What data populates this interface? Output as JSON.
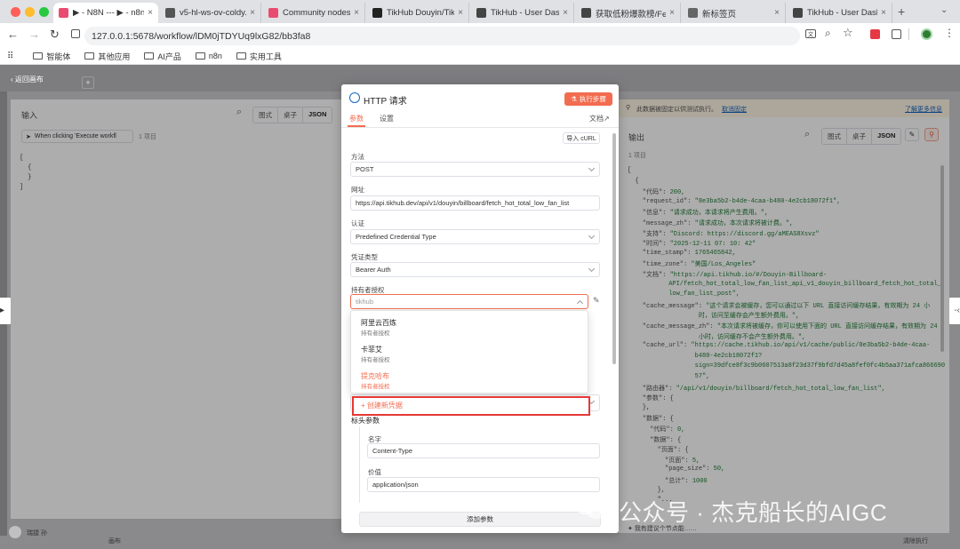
{
  "browser": {
    "tabs": [
      {
        "title": "▶ - N8N --- ▶ - n8n",
        "active": true,
        "fav": "#ea4b71"
      },
      {
        "title": "v5-hl-ws-ov-coldy.d",
        "active": false,
        "fav": "#555"
      },
      {
        "title": "Community nodes",
        "active": false,
        "fav": "#ea4b71"
      },
      {
        "title": "TikHub Douyin/TikTo",
        "active": false,
        "fav": "#222"
      },
      {
        "title": "TikHub - User Dash",
        "active": false,
        "fav": "#444"
      },
      {
        "title": "获取低粉爆款榜/Fetc",
        "active": false,
        "fav": "#444"
      },
      {
        "title": "新标签页",
        "active": false,
        "fav": "#666"
      },
      {
        "title": "TikHub - User Dash",
        "active": false,
        "fav": "#444"
      }
    ],
    "url": "127.0.0.1:5678/workflow/lDM0jTDYUq9lxG82/bb3fa8",
    "bookmarks": [
      "智能体",
      "其他应用",
      "AI产品",
      "n8n",
      "实用工具"
    ]
  },
  "canvas": {
    "back_label": "返回画布",
    "user_label": "瑞捷 孙",
    "bottom_label": "画布"
  },
  "input_panel": {
    "title": "输入",
    "view_modes": [
      "图式",
      "桌子",
      "JSON"
    ],
    "trigger_select": "When clicking 'Execute workfl",
    "item_count": "1 项目",
    "json_lines": [
      "[",
      "  {",
      "  }",
      "]"
    ]
  },
  "http_panel": {
    "title": "HTTP 请求",
    "execute_button": "执行步骤",
    "tabs": {
      "params": "参数",
      "settings": "设置",
      "docs": "文档"
    },
    "import_curl": "导入 cURL",
    "method_label": "方法",
    "method_value": "POST",
    "url_label": "网址",
    "url_value": "https://api.tikhub.dev/api/v1/douyin/billboard/fetch_hot_total_low_fan_list",
    "auth_label": "认证",
    "auth_value": "Predefined Credential Type",
    "credential_type_label": "凭证类型",
    "credential_type_value": "Bearer Auth",
    "bearer_label": "持有者授权",
    "bearer_search_value": "tikhub",
    "dropdown": [
      {
        "name": "阿里云百炼",
        "sub": "持有者授权",
        "highlight": false
      },
      {
        "name": "卡菲艾",
        "sub": "持有者授权",
        "highlight": false
      },
      {
        "name": "提克哈布",
        "sub": "持有者授权",
        "highlight": true
      }
    ],
    "create_credential": "+ 创建新凭据",
    "headers_label": "标头参数",
    "header_name_label": "名字",
    "header_name_value": "Content-Type",
    "header_value_label": "价值",
    "header_value_value": "application/json",
    "add_param": "添加参数"
  },
  "output_panel": {
    "notice": "此数据被固定以供测试执行。",
    "unpin": "取消固定",
    "learn_more": "了解更多信息",
    "title": "输出",
    "view_modes": [
      "图式",
      "桌子",
      "JSON"
    ],
    "item_count": "1 项目",
    "json_lines": [
      [
        {
          "t": "[",
          "c": "p"
        }
      ],
      [
        {
          "t": "  {",
          "c": "p"
        }
      ],
      [
        {
          "t": "    \"代码\": ",
          "c": "k"
        },
        {
          "t": "200,",
          "c": "n"
        }
      ],
      [
        {
          "t": "    \"request_id\": ",
          "c": "k"
        },
        {
          "t": "\"8e3ba5b2-b4de-4caa-b480-4e2cb18072f1\",",
          "c": "s"
        }
      ],
      [
        {
          "t": "    \"信息\": ",
          "c": "k"
        },
        {
          "t": "\"请求成功，本请求将产生费用。\",",
          "c": "s"
        }
      ],
      [
        {
          "t": "    \"message_zh\": ",
          "c": "k"
        },
        {
          "t": "\"请求成功，本次请求将被计费。\",",
          "c": "s"
        }
      ],
      [
        {
          "t": "    \"支持\": ",
          "c": "k"
        },
        {
          "t": "\"Discord: https://discord.gg/aMEAS8Xsvz\"",
          "c": "s"
        }
      ],
      [
        {
          "t": "    \"时间\": ",
          "c": "k"
        },
        {
          "t": "\"2025-12-11 07: 10: 42\"",
          "c": "s"
        }
      ],
      [
        {
          "t": "    \"time_stamp\": ",
          "c": "k"
        },
        {
          "t": "1765465842,",
          "c": "n"
        }
      ],
      [
        {
          "t": "    \"time_zone\": ",
          "c": "k"
        },
        {
          "t": "\"美国/Los_Angeles\"",
          "c": "s"
        }
      ],
      [
        {
          "t": "    \"文档\": ",
          "c": "k"
        },
        {
          "t": "\"https://api.tikhub.io/#/Douyin-Billboard-",
          "c": "s"
        }
      ],
      [
        {
          "t": "           API/fetch_hot_total_low_fan_list_api_v1_douyin_billboard_fetch_hot_total_",
          "c": "s"
        }
      ],
      [
        {
          "t": "           low_fan_list_post\",",
          "c": "s"
        }
      ],
      [
        {
          "t": "    \"cache_message\": ",
          "c": "k"
        },
        {
          "t": "\"这个请求会被缓存，您可以通过以下 URL 直接访问缓存结果，有效期为 24 小",
          "c": "s"
        }
      ],
      [
        {
          "t": "                   时，访问至缓存会产生额外费用。\",",
          "c": "s"
        }
      ],
      [
        {
          "t": "    \"cache_message_zh\": ",
          "c": "k"
        },
        {
          "t": "\"本次请求将被缓存，你可以使用下面的 URL 直接访问缓存结果，有效期为 24",
          "c": "s"
        }
      ],
      [
        {
          "t": "                   小时，访问缓存不会产生额外费用。\",",
          "c": "s"
        }
      ],
      [
        {
          "t": "    \"cache_url\": ",
          "c": "k"
        },
        {
          "t": "\"https://cache.tikhub.io/api/v1/cache/public/8e3ba5b2-b4de-4caa-",
          "c": "s"
        }
      ],
      [
        {
          "t": "                  b480-4e2cb18072f1?",
          "c": "s"
        }
      ],
      [
        {
          "t": "                  sign=39dfce8f3c9b0607513a8f23d37f9bfd7d45a8fef0fc4b5aa371afca866690",
          "c": "s"
        }
      ],
      [
        {
          "t": "                  57\",",
          "c": "s"
        }
      ],
      [
        {
          "t": "    \"路由器\": ",
          "c": "k"
        },
        {
          "t": "\"/api/v1/douyin/billboard/fetch_hot_total_low_fan_list\",",
          "c": "s"
        }
      ],
      [
        {
          "t": "    \"参数\": ",
          "c": "k"
        },
        {
          "t": "{",
          "c": "p"
        }
      ],
      [
        {
          "t": "    },",
          "c": "p"
        }
      ],
      [
        {
          "t": "    \"数据\": ",
          "c": "k"
        },
        {
          "t": "{",
          "c": "p"
        }
      ],
      [
        {
          "t": "      \"代码\": ",
          "c": "k"
        },
        {
          "t": "0,",
          "c": "n"
        }
      ],
      [
        {
          "t": "      \"数据\": ",
          "c": "k"
        },
        {
          "t": "{",
          "c": "p"
        }
      ],
      [
        {
          "t": "        \"页面\": ",
          "c": "k"
        },
        {
          "t": "{",
          "c": "p"
        }
      ],
      [
        {
          "t": "          \"页面\": ",
          "c": "k"
        },
        {
          "t": "5,",
          "c": "n"
        }
      ],
      [
        {
          "t": "          \"page_size\": ",
          "c": "k"
        },
        {
          "t": "50,",
          "c": "n"
        }
      ],
      [
        {
          "t": "          \"总计\": ",
          "c": "k"
        },
        {
          "t": "1000",
          "c": "n"
        }
      ],
      [
        {
          "t": "        },",
          "c": "p"
        }
      ],
      [
        {
          "t": "        \"...",
          "c": "p"
        }
      ]
    ],
    "footer_hint": "我有建议个节点能……"
  },
  "watermark": "公众号 · 杰克船长的AIGC",
  "footer_right": "清除执行"
}
